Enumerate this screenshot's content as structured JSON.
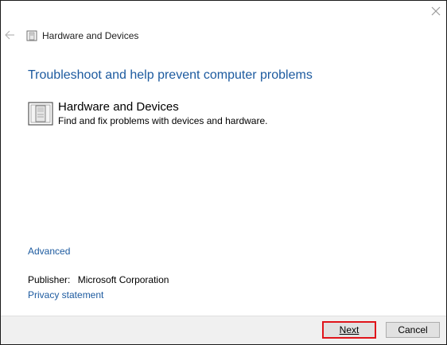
{
  "window": {
    "title": "Hardware and Devices"
  },
  "icons": {
    "close": "close-icon",
    "back": "back-arrow-icon",
    "troubleshooter": "hardware-devices-icon"
  },
  "main": {
    "heading": "Troubleshoot and help prevent computer problems",
    "item": {
      "title": "Hardware and Devices",
      "description": "Find and fix problems with devices and hardware."
    },
    "advanced_link": "Advanced",
    "publisher_label": "Publisher:",
    "publisher_value": "Microsoft Corporation",
    "privacy_link": "Privacy statement"
  },
  "footer": {
    "next_label": "Next",
    "cancel_label": "Cancel"
  },
  "colors": {
    "link": "#1c5a9f",
    "highlight_border": "#e0141b"
  }
}
